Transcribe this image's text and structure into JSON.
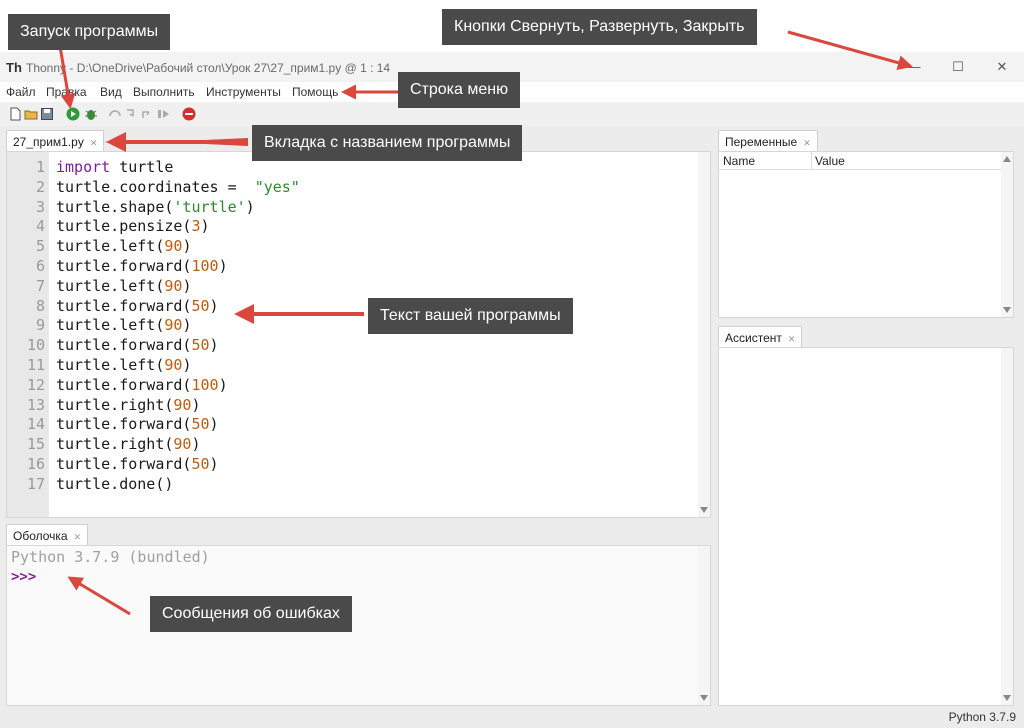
{
  "titlebar": {
    "app_name": "Thonny",
    "title": "Thonny  -  D:\\OneDrive\\Рабочий стол\\Урок 27\\27_прим1.py  @  1 : 14",
    "minimize_icon": "—",
    "maximize_icon": "☐",
    "close_icon": "✕"
  },
  "menu": [
    "Файл",
    "Правка",
    "Вид",
    "Выполнить",
    "Инструменты",
    "Помощь"
  ],
  "editor": {
    "tab_label": "27_прим1.py",
    "line_numbers": [
      "1",
      "2",
      "3",
      "4",
      "5",
      "6",
      "7",
      "8",
      "9",
      "10",
      "11",
      "12",
      "13",
      "14",
      "15",
      "16",
      "17"
    ],
    "lines": [
      [
        {
          "t": "import",
          "c": "kw"
        },
        {
          "t": " turtle",
          "c": ""
        }
      ],
      [
        {
          "t": "turtle.coordinates =  ",
          "c": ""
        },
        {
          "t": "\"yes\"",
          "c": "str"
        }
      ],
      [
        {
          "t": "turtle.shape(",
          "c": ""
        },
        {
          "t": "'turtle'",
          "c": "str"
        },
        {
          "t": ")",
          "c": ""
        }
      ],
      [
        {
          "t": "turtle.pensize(",
          "c": ""
        },
        {
          "t": "3",
          "c": "num"
        },
        {
          "t": ")",
          "c": ""
        }
      ],
      [
        {
          "t": "turtle.left(",
          "c": ""
        },
        {
          "t": "90",
          "c": "num"
        },
        {
          "t": ")",
          "c": ""
        }
      ],
      [
        {
          "t": "turtle.forward(",
          "c": ""
        },
        {
          "t": "100",
          "c": "num"
        },
        {
          "t": ")",
          "c": ""
        }
      ],
      [
        {
          "t": "turtle.left(",
          "c": ""
        },
        {
          "t": "90",
          "c": "num"
        },
        {
          "t": ")",
          "c": ""
        }
      ],
      [
        {
          "t": "turtle.forward(",
          "c": ""
        },
        {
          "t": "50",
          "c": "num"
        },
        {
          "t": ")",
          "c": ""
        }
      ],
      [
        {
          "t": "turtle.left(",
          "c": ""
        },
        {
          "t": "90",
          "c": "num"
        },
        {
          "t": ")",
          "c": ""
        }
      ],
      [
        {
          "t": "turtle.forward(",
          "c": ""
        },
        {
          "t": "50",
          "c": "num"
        },
        {
          "t": ")",
          "c": ""
        }
      ],
      [
        {
          "t": "turtle.left(",
          "c": ""
        },
        {
          "t": "90",
          "c": "num"
        },
        {
          "t": ")",
          "c": ""
        }
      ],
      [
        {
          "t": "turtle.forward(",
          "c": ""
        },
        {
          "t": "100",
          "c": "num"
        },
        {
          "t": ")",
          "c": ""
        }
      ],
      [
        {
          "t": "turtle.right(",
          "c": ""
        },
        {
          "t": "90",
          "c": "num"
        },
        {
          "t": ")",
          "c": ""
        }
      ],
      [
        {
          "t": "turtle.forward(",
          "c": ""
        },
        {
          "t": "50",
          "c": "num"
        },
        {
          "t": ")",
          "c": ""
        }
      ],
      [
        {
          "t": "turtle.right(",
          "c": ""
        },
        {
          "t": "90",
          "c": "num"
        },
        {
          "t": ")",
          "c": ""
        }
      ],
      [
        {
          "t": "turtle.forward(",
          "c": ""
        },
        {
          "t": "50",
          "c": "num"
        },
        {
          "t": ")",
          "c": ""
        }
      ],
      [
        {
          "t": "turtle.done()",
          "c": ""
        }
      ]
    ]
  },
  "shell": {
    "tab_label": "Оболочка",
    "banner": "Python 3.7.9 (bundled)",
    "prompt": ">>>"
  },
  "variables": {
    "tab_label": "Переменные",
    "col_name": "Name",
    "col_value": "Value"
  },
  "assistant": {
    "tab_label": "Ассистент"
  },
  "status": {
    "python_version": "Python 3.7.9"
  },
  "annotations": {
    "run": "Запуск программы",
    "window_buttons": "Кнопки Свернуть, Развернуть, Закрыть",
    "menu_bar": "Строка меню",
    "tab": "Вкладка с названием программы",
    "program_text": "Текст вашей программы",
    "errors": "Сообщения об ошибках"
  },
  "colors": {
    "annotation_bg": "#4a4a4a",
    "arrow": "#d9473d",
    "keyword": "#7a1f9a",
    "string": "#2e8b2e",
    "number": "#c15a10",
    "prompt": "#8b1f9a"
  },
  "icons": [
    "new-file-icon",
    "open-folder-icon",
    "save-icon",
    "run-icon",
    "debug-icon",
    "step-over-icon",
    "step-into-icon",
    "step-out-icon",
    "resume-icon",
    "stop-icon"
  ]
}
